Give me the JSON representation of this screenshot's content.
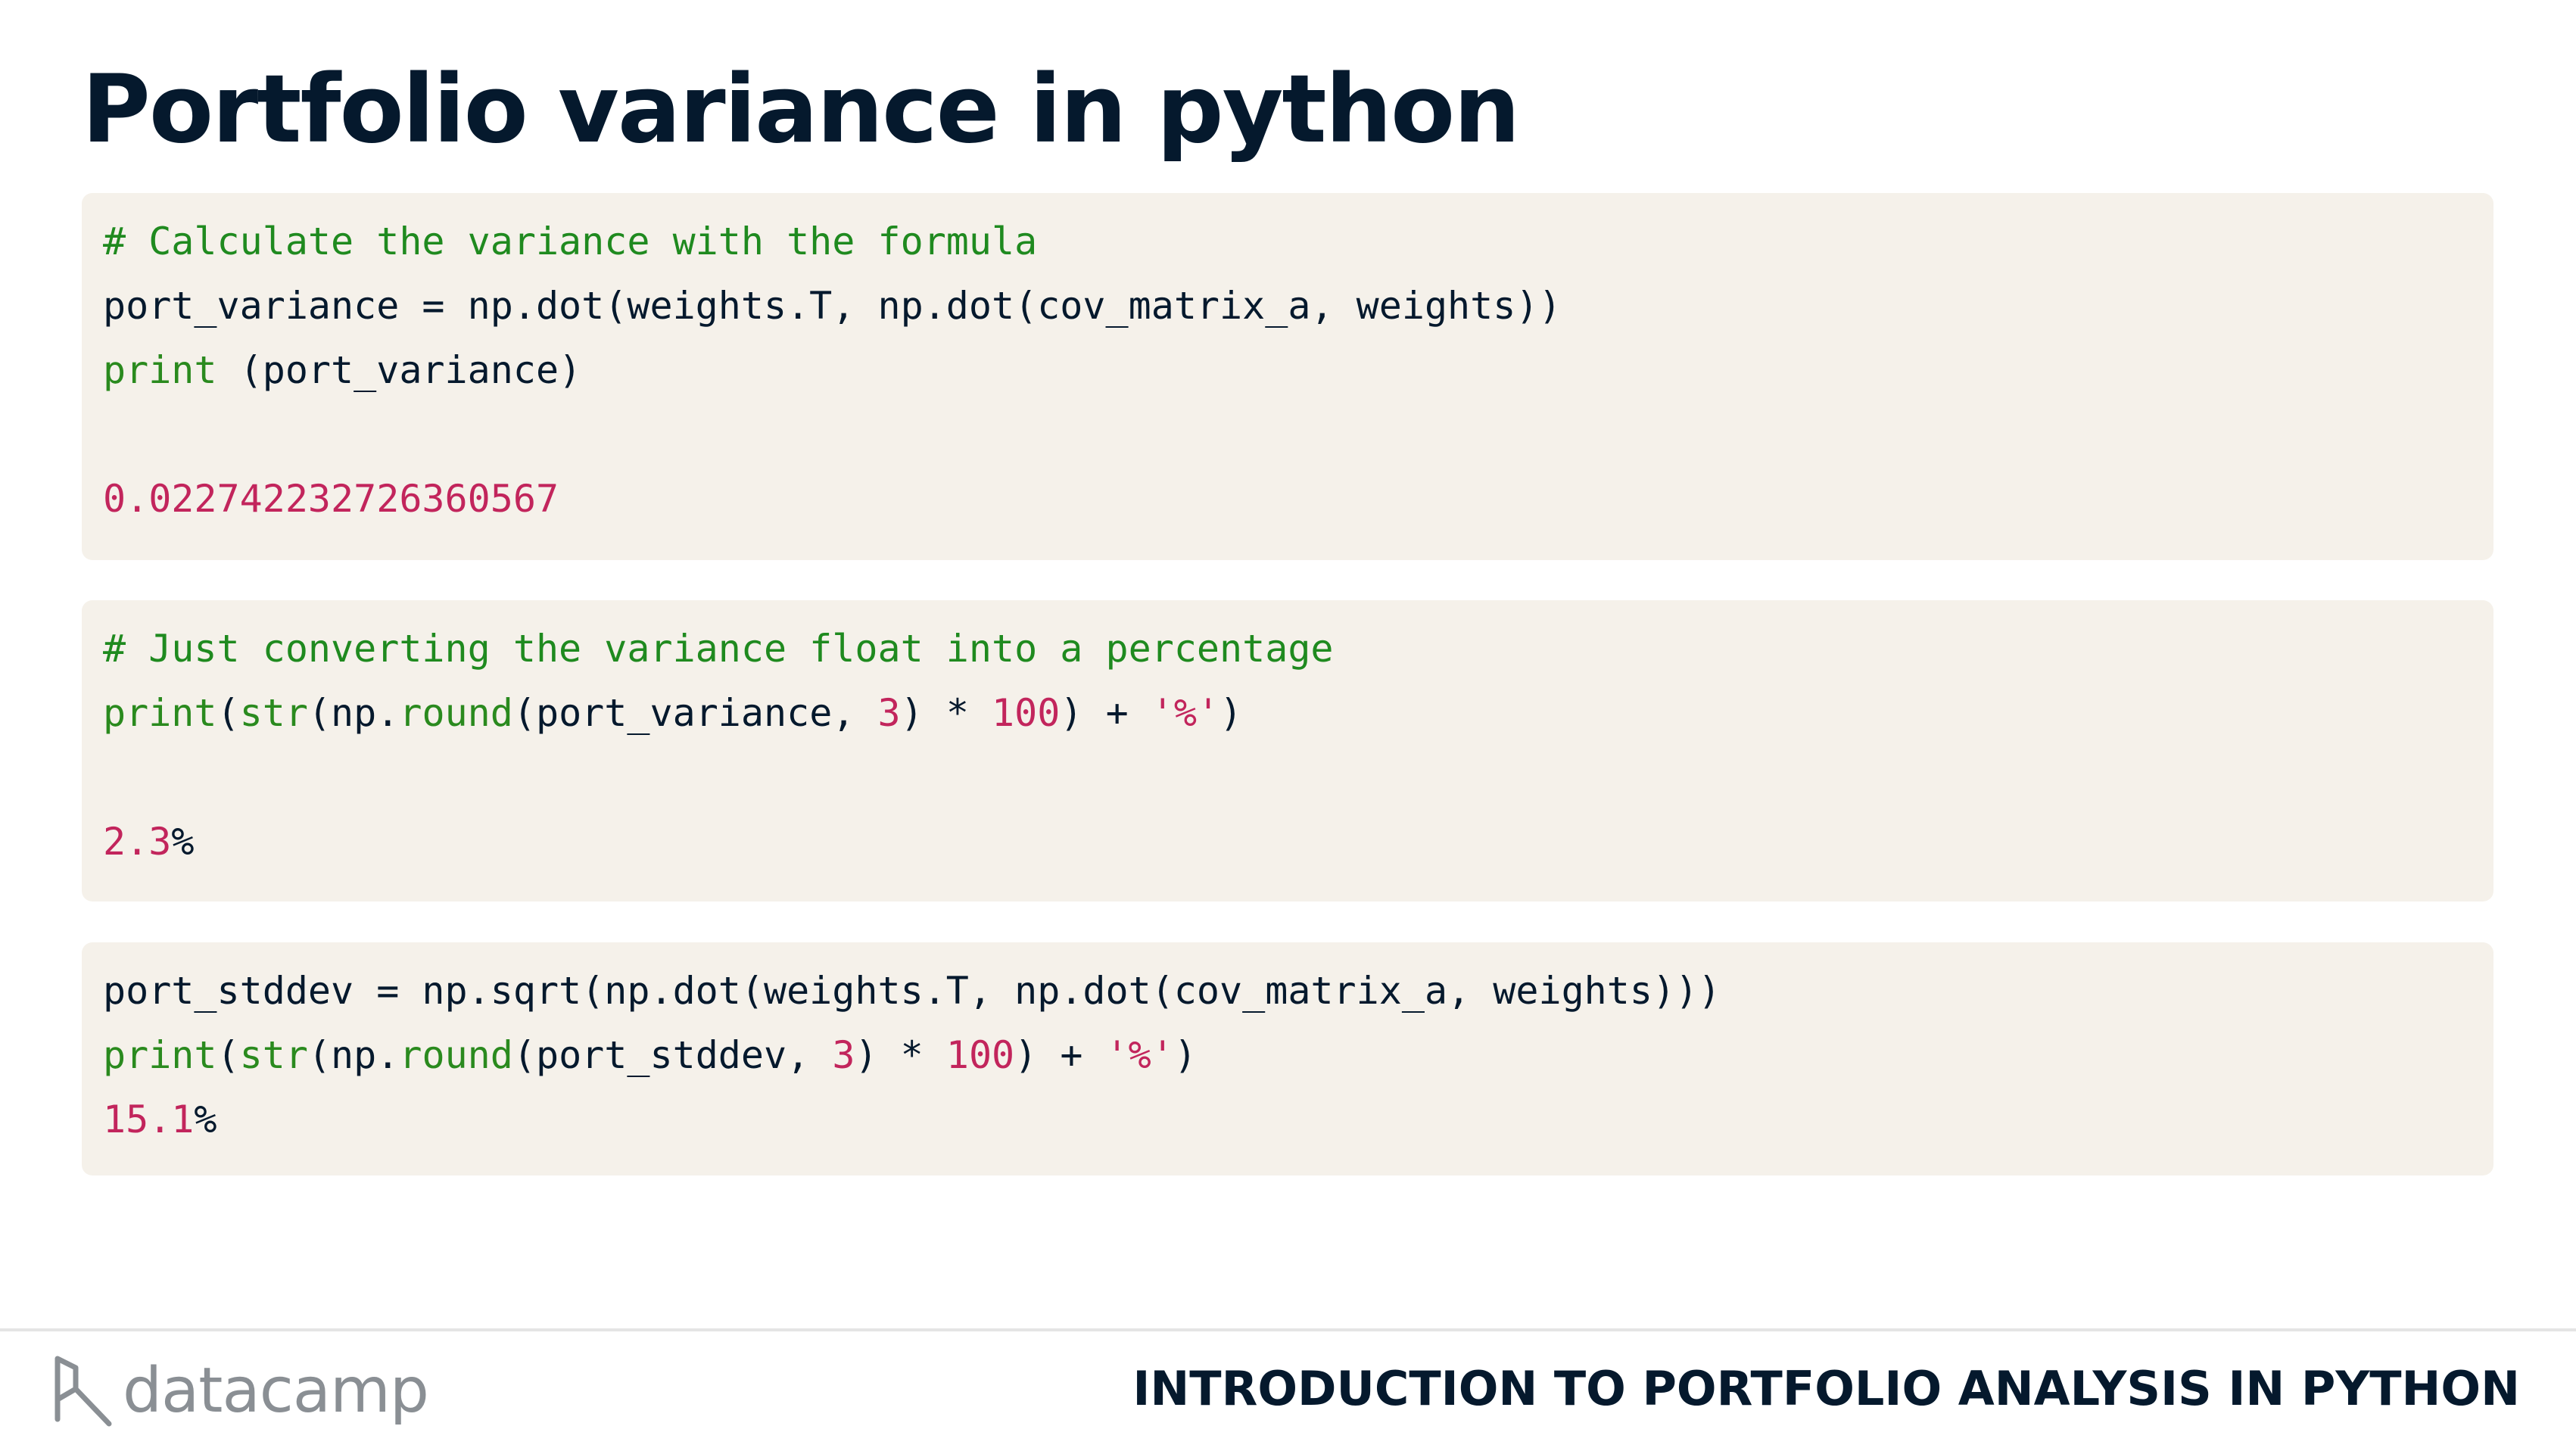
{
  "slide": {
    "title": "Portfolio variance in python"
  },
  "code_blocks": [
    {
      "lines": [
        [
          {
            "t": "# Calculate the variance with the formula",
            "k": "comment"
          }
        ],
        [
          {
            "t": "port_variance = np.dot(weights.T, np.dot(cov_matrix_a, weights))",
            "k": "plain"
          }
        ],
        [
          {
            "t": "print",
            "k": "builtin"
          },
          {
            "t": " (port_variance)",
            "k": "plain"
          }
        ],
        [
          {
            "t": "",
            "k": "plain"
          }
        ],
        [
          {
            "t": "0.022742232726360567",
            "k": "number"
          }
        ]
      ]
    },
    {
      "lines": [
        [
          {
            "t": "# Just converting the variance float into a percentage",
            "k": "comment"
          }
        ],
        [
          {
            "t": "print",
            "k": "builtin"
          },
          {
            "t": "(",
            "k": "plain"
          },
          {
            "t": "str",
            "k": "builtin"
          },
          {
            "t": "(np.",
            "k": "plain"
          },
          {
            "t": "round",
            "k": "builtin"
          },
          {
            "t": "(port_variance, ",
            "k": "plain"
          },
          {
            "t": "3",
            "k": "number"
          },
          {
            "t": ") * ",
            "k": "plain"
          },
          {
            "t": "100",
            "k": "number"
          },
          {
            "t": ") + ",
            "k": "plain"
          },
          {
            "t": "'%'",
            "k": "number"
          },
          {
            "t": ")",
            "k": "plain"
          }
        ],
        [
          {
            "t": "",
            "k": "plain"
          }
        ],
        [
          {
            "t": "2.3",
            "k": "number"
          },
          {
            "t": "%",
            "k": "plain"
          }
        ]
      ]
    },
    {
      "lines": [
        [
          {
            "t": "port_stddev = np.sqrt(np.dot(weights.T, np.dot(cov_matrix_a, weights)))",
            "k": "plain"
          }
        ],
        [
          {
            "t": "print",
            "k": "builtin"
          },
          {
            "t": "(",
            "k": "plain"
          },
          {
            "t": "str",
            "k": "builtin"
          },
          {
            "t": "(np.",
            "k": "plain"
          },
          {
            "t": "round",
            "k": "builtin"
          },
          {
            "t": "(port_stddev, ",
            "k": "plain"
          },
          {
            "t": "3",
            "k": "number"
          },
          {
            "t": ") * ",
            "k": "plain"
          },
          {
            "t": "100",
            "k": "number"
          },
          {
            "t": ") + ",
            "k": "plain"
          },
          {
            "t": "'%'",
            "k": "number"
          },
          {
            "t": ")",
            "k": "plain"
          }
        ],
        [
          {
            "t": "15.1",
            "k": "number"
          },
          {
            "t": "%",
            "k": "plain"
          }
        ]
      ]
    }
  ],
  "footer": {
    "logo_text": "datacamp",
    "logo_icon": "datacamp-logo-icon",
    "course_title": "INTRODUCTION TO PORTFOLIO ANALYSIS IN PYTHON"
  },
  "colors": {
    "title": "#05192d",
    "code_background": "#f5f1ea",
    "comment": "#1f8a1f",
    "builtin": "#2a8a1e",
    "number": "#c2255c",
    "logo": "#8a8f94"
  }
}
